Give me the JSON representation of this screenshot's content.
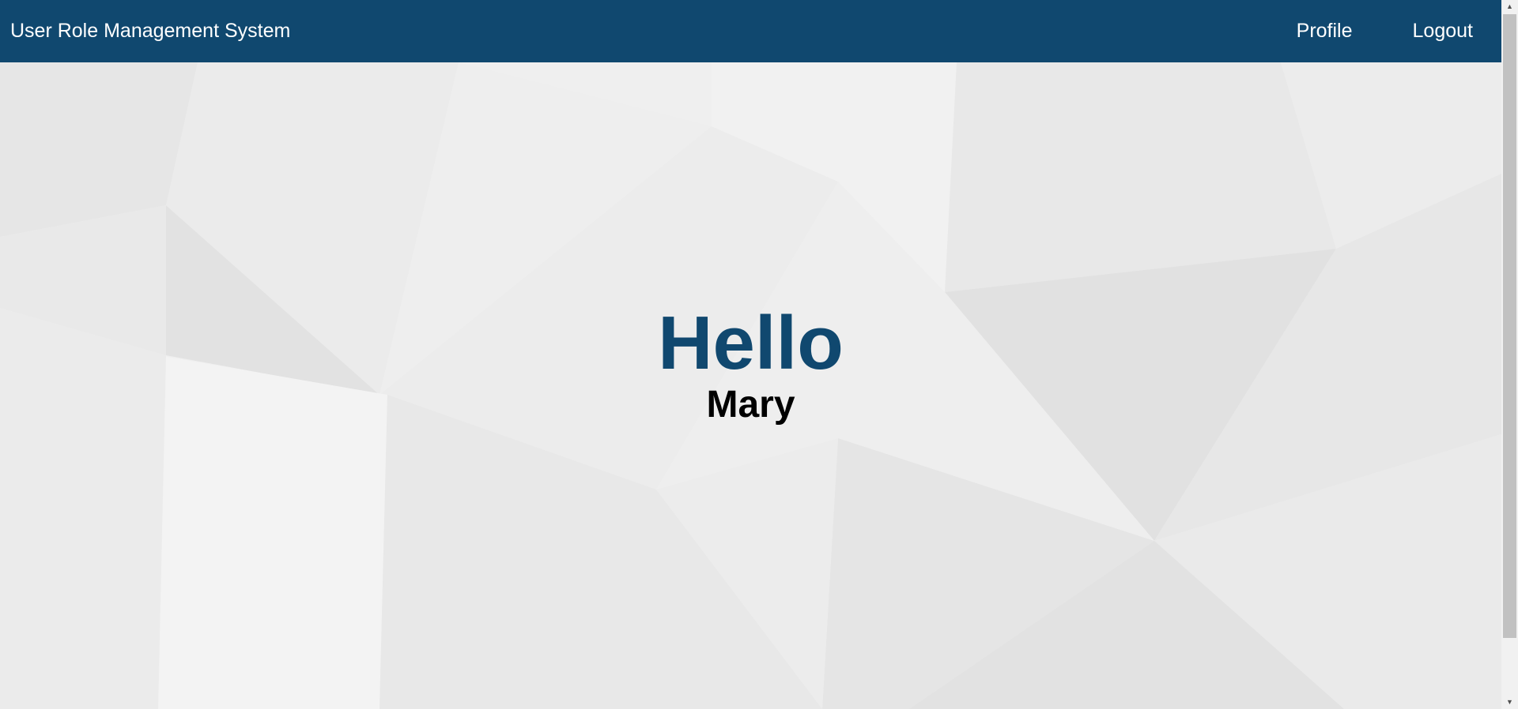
{
  "navbar": {
    "brand": "User Role Management System",
    "links": [
      {
        "label": "Profile"
      },
      {
        "label": "Logout"
      }
    ],
    "background_color": "#10486f"
  },
  "hero": {
    "greeting": "Hello",
    "name": "Mary",
    "greeting_color": "#10486f"
  },
  "scrollbar": {
    "up_icon": "triangle-up-icon",
    "down_icon": "triangle-down-icon"
  }
}
